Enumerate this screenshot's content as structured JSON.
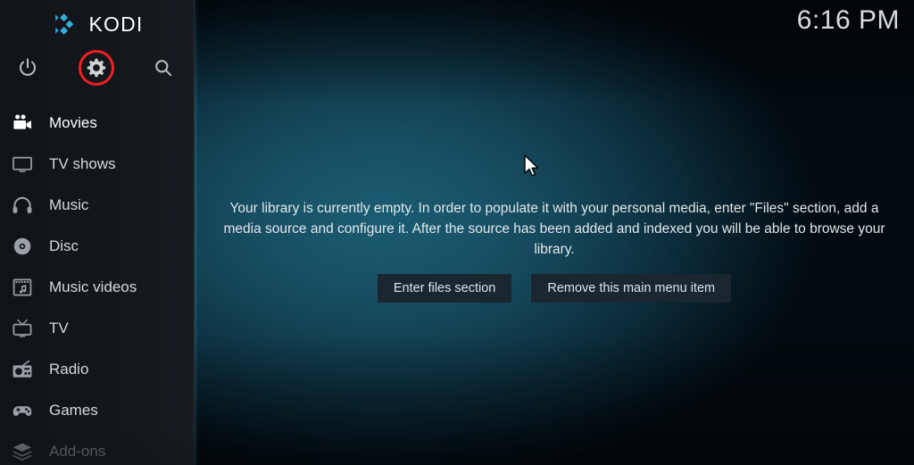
{
  "app": {
    "name": "KODI",
    "logo_color": "#35AEDC"
  },
  "header": {
    "clock": "6:16 PM"
  },
  "sidebar": {
    "actions": [
      {
        "name": "power-icon",
        "label": "Power"
      },
      {
        "name": "settings-icon",
        "label": "Settings",
        "highlighted": true,
        "highlight_color": "#EF1F22"
      },
      {
        "name": "search-icon",
        "label": "Search"
      }
    ],
    "items": [
      {
        "label": "Movies",
        "icon": "movie-camera-icon",
        "state": "active"
      },
      {
        "label": "TV shows",
        "icon": "television-icon",
        "state": "normal"
      },
      {
        "label": "Music",
        "icon": "headphones-icon",
        "state": "normal"
      },
      {
        "label": "Disc",
        "icon": "disc-icon",
        "state": "normal"
      },
      {
        "label": "Music videos",
        "icon": "film-note-icon",
        "state": "normal"
      },
      {
        "label": "TV",
        "icon": "retro-tv-icon",
        "state": "normal"
      },
      {
        "label": "Radio",
        "icon": "radio-icon",
        "state": "normal"
      },
      {
        "label": "Games",
        "icon": "gamepad-icon",
        "state": "normal"
      },
      {
        "label": "Add-ons",
        "icon": "addon-box-icon",
        "state": "dim"
      }
    ]
  },
  "main": {
    "empty_message": "Your library is currently empty. In order to populate it with your personal media, enter \"Files\" section, add a media source and configure it. After the source has been added and indexed you will be able to browse your library.",
    "buttons": [
      {
        "label": "Enter files section",
        "name": "enter-files-section-button"
      },
      {
        "label": "Remove this main menu item",
        "name": "remove-main-menu-item-button"
      }
    ]
  },
  "colors": {
    "background_teal": "#1B5C73",
    "sidebar": "#14181D",
    "button": "#1A2630",
    "accent_red": "#EF1F22"
  }
}
